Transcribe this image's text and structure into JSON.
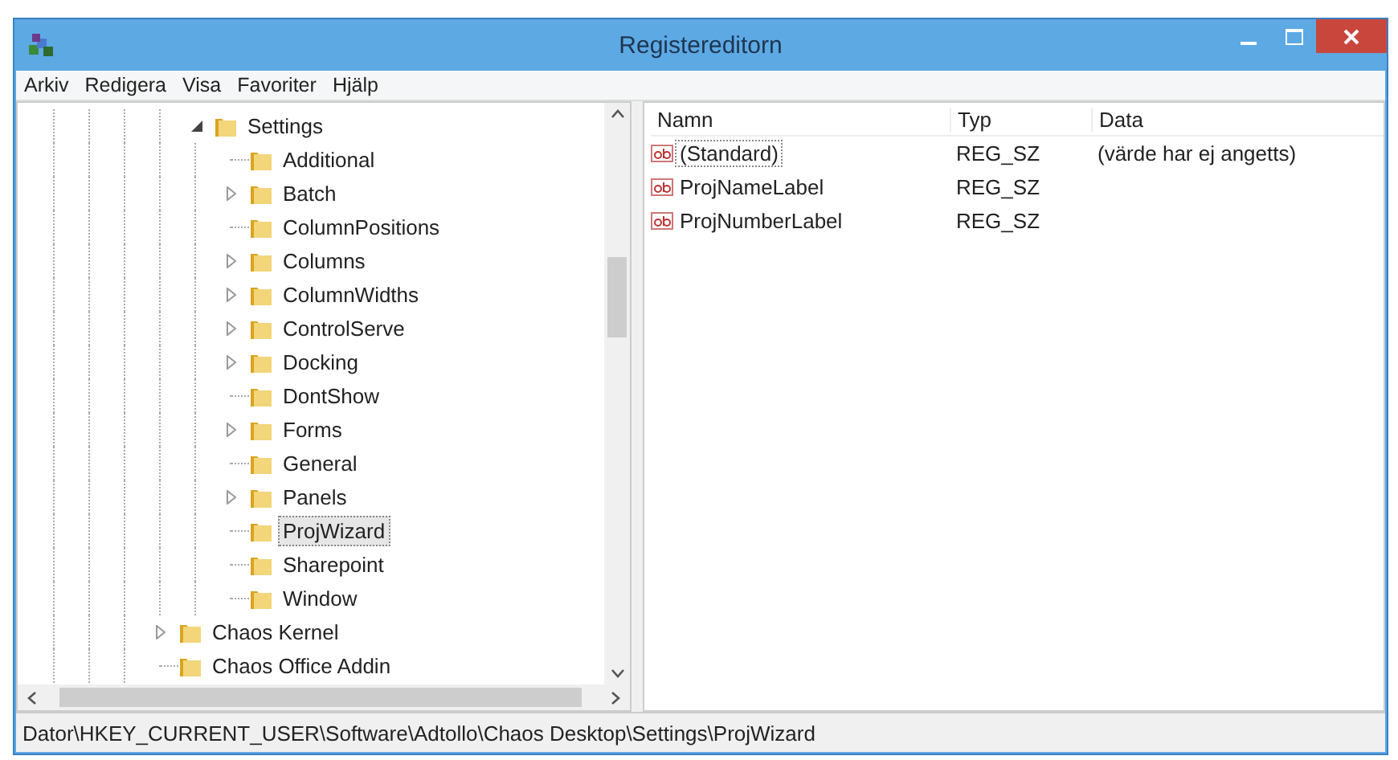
{
  "window": {
    "title": "Registereditorn"
  },
  "menu": [
    "Arkiv",
    "Redigera",
    "Visa",
    "Favoriter",
    "Hjälp"
  ],
  "tree": {
    "items": [
      {
        "label": "Settings",
        "expanded": true,
        "selected": false,
        "children": [
          {
            "label": "Additional",
            "selected": false
          },
          {
            "label": "Batch",
            "expanded": false,
            "selected": false
          },
          {
            "label": "ColumnPositions",
            "selected": false
          },
          {
            "label": "Columns",
            "expanded": false,
            "selected": false
          },
          {
            "label": "ColumnWidths",
            "expanded": false,
            "selected": false
          },
          {
            "label": "ControlServe",
            "expanded": false,
            "selected": false
          },
          {
            "label": "Docking",
            "expanded": false,
            "selected": false
          },
          {
            "label": "DontShow",
            "selected": false
          },
          {
            "label": "Forms",
            "expanded": false,
            "selected": false
          },
          {
            "label": "General",
            "selected": false
          },
          {
            "label": "Panels",
            "expanded": false,
            "selected": false
          },
          {
            "label": "ProjWizard",
            "selected": true
          },
          {
            "label": "Sharepoint",
            "selected": false
          },
          {
            "label": "Window",
            "selected": false
          }
        ]
      }
    ],
    "parent_siblings": [
      {
        "label": "Chaos Kernel",
        "expanded": false,
        "selected": false
      },
      {
        "label": "Chaos Office Addin",
        "selected": false
      }
    ]
  },
  "values": {
    "columns": [
      "Namn",
      "Typ",
      "Data"
    ],
    "rows": [
      {
        "name": "(Standard)",
        "type": "REG_SZ",
        "data": "(värde har ej angetts)",
        "selected": true
      },
      {
        "name": "ProjNameLabel",
        "type": "REG_SZ",
        "selected": false
      },
      {
        "name": "ProjNumberLabel",
        "type": "REG_SZ",
        "selected": false
      }
    ]
  },
  "status_bar": "Dator\\HKEY_CURRENT_USER\\Software\\Adtollo\\Chaos Desktop\\Settings\\ProjWizard"
}
